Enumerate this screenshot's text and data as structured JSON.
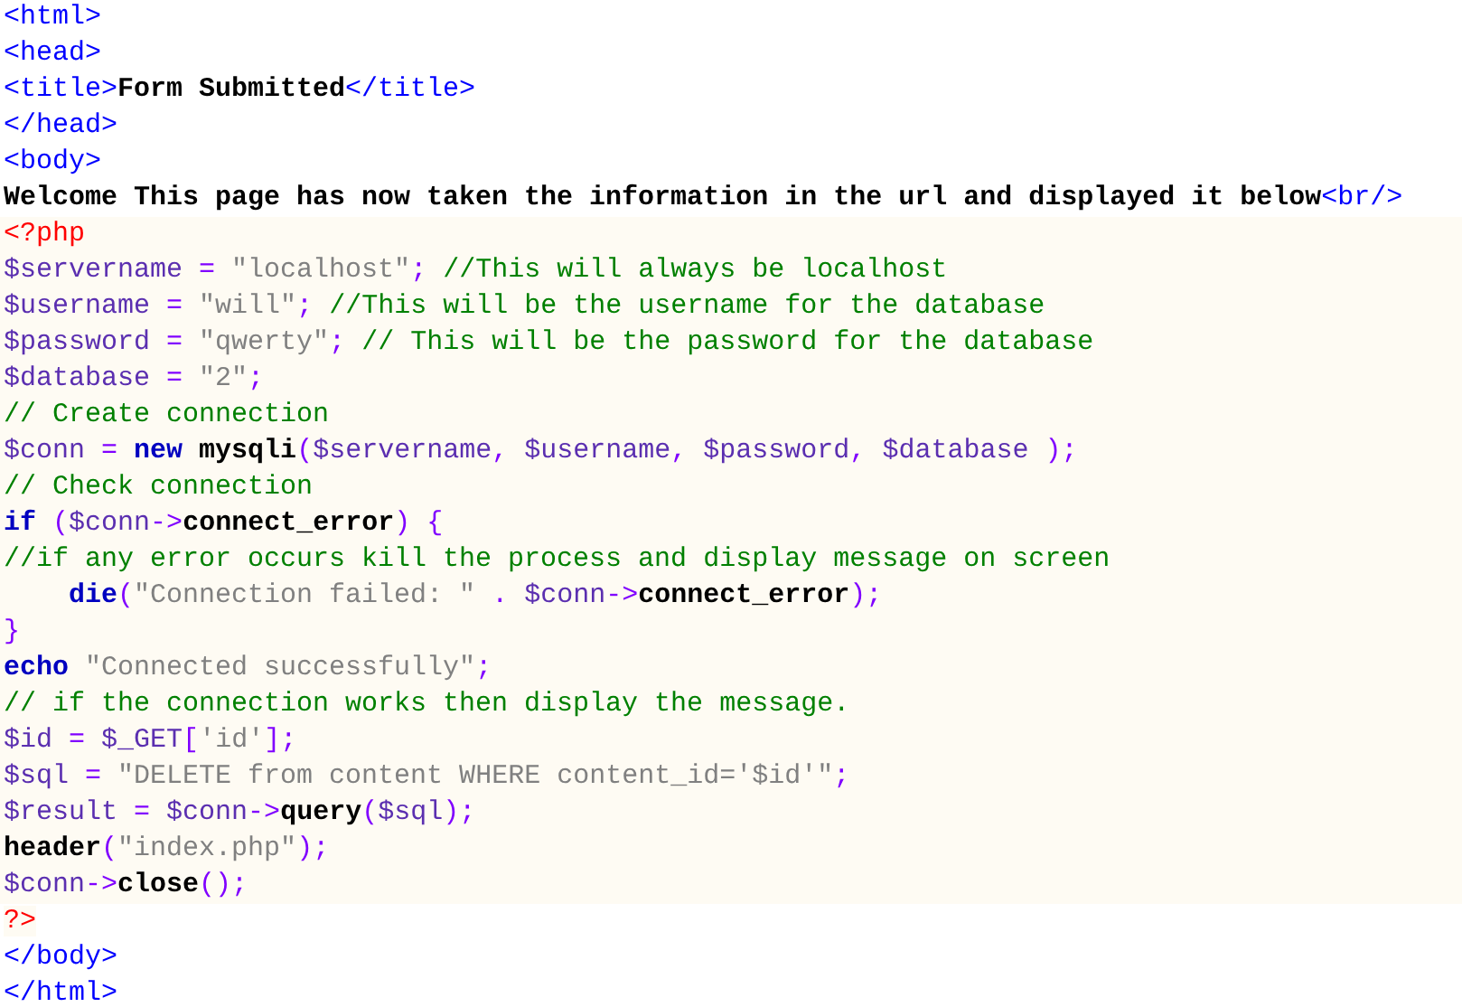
{
  "lines": [
    {
      "embedded": false,
      "tokens": [
        {
          "kind": "tag",
          "text": "<html>"
        }
      ]
    },
    {
      "embedded": false,
      "tokens": [
        {
          "kind": "tag",
          "text": "<head>"
        }
      ]
    },
    {
      "embedded": false,
      "tokens": [
        {
          "kind": "tag",
          "text": "<title>"
        },
        {
          "kind": "text",
          "text": "Form Submitted"
        },
        {
          "kind": "tag",
          "text": "</title>"
        }
      ]
    },
    {
      "embedded": false,
      "tokens": [
        {
          "kind": "tag",
          "text": "</head>"
        }
      ]
    },
    {
      "embedded": false,
      "tokens": [
        {
          "kind": "tag",
          "text": "<body>"
        }
      ]
    },
    {
      "embedded": false,
      "tokens": [
        {
          "kind": "text",
          "text": "Welcome This page has now taken the information in the url and displayed it below"
        },
        {
          "kind": "tag",
          "text": "<br/>"
        }
      ]
    },
    {
      "embedded": true,
      "tokens": [
        {
          "kind": "php",
          "text": "<?php"
        }
      ]
    },
    {
      "embedded": true,
      "tokens": [
        {
          "kind": "var",
          "text": "$servername"
        },
        {
          "kind": "op",
          "text": " = "
        },
        {
          "kind": "string",
          "text": "\"localhost\""
        },
        {
          "kind": "op",
          "text": "; "
        },
        {
          "kind": "comment",
          "text": "//This will always be localhost"
        }
      ]
    },
    {
      "embedded": true,
      "tokens": [
        {
          "kind": "var",
          "text": "$username"
        },
        {
          "kind": "op",
          "text": " = "
        },
        {
          "kind": "string",
          "text": "\"will\""
        },
        {
          "kind": "op",
          "text": "; "
        },
        {
          "kind": "comment",
          "text": "//This will be the username for the database"
        }
      ]
    },
    {
      "embedded": true,
      "tokens": [
        {
          "kind": "var",
          "text": "$password"
        },
        {
          "kind": "op",
          "text": " = "
        },
        {
          "kind": "string",
          "text": "\"qwerty\""
        },
        {
          "kind": "op",
          "text": "; "
        },
        {
          "kind": "comment",
          "text": "// This will be the password for the database"
        }
      ]
    },
    {
      "embedded": true,
      "tokens": [
        {
          "kind": "var",
          "text": "$database"
        },
        {
          "kind": "op",
          "text": " = "
        },
        {
          "kind": "string",
          "text": "\"2\""
        },
        {
          "kind": "op",
          "text": ";"
        }
      ]
    },
    {
      "embedded": true,
      "tokens": [
        {
          "kind": "comment",
          "text": "// Create connection"
        }
      ]
    },
    {
      "embedded": true,
      "tokens": [
        {
          "kind": "var",
          "text": "$conn"
        },
        {
          "kind": "op",
          "text": " = "
        },
        {
          "kind": "keyword",
          "text": "new"
        },
        {
          "kind": "ident",
          "text": " mysqli"
        },
        {
          "kind": "op",
          "text": "("
        },
        {
          "kind": "var",
          "text": "$servername"
        },
        {
          "kind": "op",
          "text": ", "
        },
        {
          "kind": "var",
          "text": "$username"
        },
        {
          "kind": "op",
          "text": ", "
        },
        {
          "kind": "var",
          "text": "$password"
        },
        {
          "kind": "op",
          "text": ", "
        },
        {
          "kind": "var",
          "text": "$database"
        },
        {
          "kind": "op",
          "text": " );"
        }
      ]
    },
    {
      "embedded": true,
      "tokens": [
        {
          "kind": "comment",
          "text": "// Check connection"
        }
      ]
    },
    {
      "embedded": true,
      "tokens": [
        {
          "kind": "keyword",
          "text": "if"
        },
        {
          "kind": "op",
          "text": " ("
        },
        {
          "kind": "var",
          "text": "$conn"
        },
        {
          "kind": "op",
          "text": "->"
        },
        {
          "kind": "ident",
          "text": "connect_error"
        },
        {
          "kind": "op",
          "text": ") {"
        }
      ]
    },
    {
      "embedded": true,
      "tokens": [
        {
          "kind": "comment",
          "text": "//if any error occurs kill the process and display message on screen"
        }
      ]
    },
    {
      "embedded": true,
      "tokens": [
        {
          "kind": "keyword",
          "text": "    die"
        },
        {
          "kind": "op",
          "text": "("
        },
        {
          "kind": "string",
          "text": "\"Connection failed: \""
        },
        {
          "kind": "op",
          "text": " . "
        },
        {
          "kind": "var",
          "text": "$conn"
        },
        {
          "kind": "op",
          "text": "->"
        },
        {
          "kind": "ident",
          "text": "connect_error"
        },
        {
          "kind": "op",
          "text": ");"
        }
      ]
    },
    {
      "embedded": true,
      "tokens": [
        {
          "kind": "op",
          "text": "}"
        }
      ]
    },
    {
      "embedded": true,
      "tokens": [
        {
          "kind": "keyword",
          "text": "echo"
        },
        {
          "kind": "string",
          "text": " \"Connected successfully\""
        },
        {
          "kind": "op",
          "text": ";"
        }
      ]
    },
    {
      "embedded": true,
      "tokens": [
        {
          "kind": "comment",
          "text": "// if the connection works then display the message."
        }
      ]
    },
    {
      "embedded": true,
      "tokens": [
        {
          "kind": "var",
          "text": "$id"
        },
        {
          "kind": "op",
          "text": " = "
        },
        {
          "kind": "var",
          "text": "$_GET"
        },
        {
          "kind": "op",
          "text": "["
        },
        {
          "kind": "string",
          "text": "'id'"
        },
        {
          "kind": "op",
          "text": "];"
        }
      ]
    },
    {
      "embedded": true,
      "tokens": [
        {
          "kind": "var",
          "text": "$sql"
        },
        {
          "kind": "op",
          "text": " = "
        },
        {
          "kind": "string",
          "text": "\"DELETE from content WHERE content_id='$id'\""
        },
        {
          "kind": "op",
          "text": ";"
        }
      ]
    },
    {
      "embedded": true,
      "tokens": [
        {
          "kind": "var",
          "text": "$result"
        },
        {
          "kind": "op",
          "text": " = "
        },
        {
          "kind": "var",
          "text": "$conn"
        },
        {
          "kind": "op",
          "text": "->"
        },
        {
          "kind": "ident",
          "text": "query"
        },
        {
          "kind": "op",
          "text": "("
        },
        {
          "kind": "var",
          "text": "$sql"
        },
        {
          "kind": "op",
          "text": ");"
        }
      ]
    },
    {
      "embedded": true,
      "tokens": [
        {
          "kind": "ident",
          "text": "header"
        },
        {
          "kind": "op",
          "text": "("
        },
        {
          "kind": "string",
          "text": "\"index.php\""
        },
        {
          "kind": "op",
          "text": ");"
        }
      ]
    },
    {
      "embedded": true,
      "tokens": [
        {
          "kind": "var",
          "text": "$conn"
        },
        {
          "kind": "op",
          "text": "->"
        },
        {
          "kind": "ident",
          "text": "close"
        },
        {
          "kind": "op",
          "text": "();"
        }
      ]
    },
    {
      "embedded": false,
      "tokens": [
        {
          "kind": "php",
          "text": "?>"
        }
      ]
    },
    {
      "embedded": false,
      "tokens": [
        {
          "kind": "tag",
          "text": "</body>"
        }
      ]
    },
    {
      "embedded": false,
      "tokens": [
        {
          "kind": "tag",
          "text": "</html>"
        }
      ]
    }
  ]
}
